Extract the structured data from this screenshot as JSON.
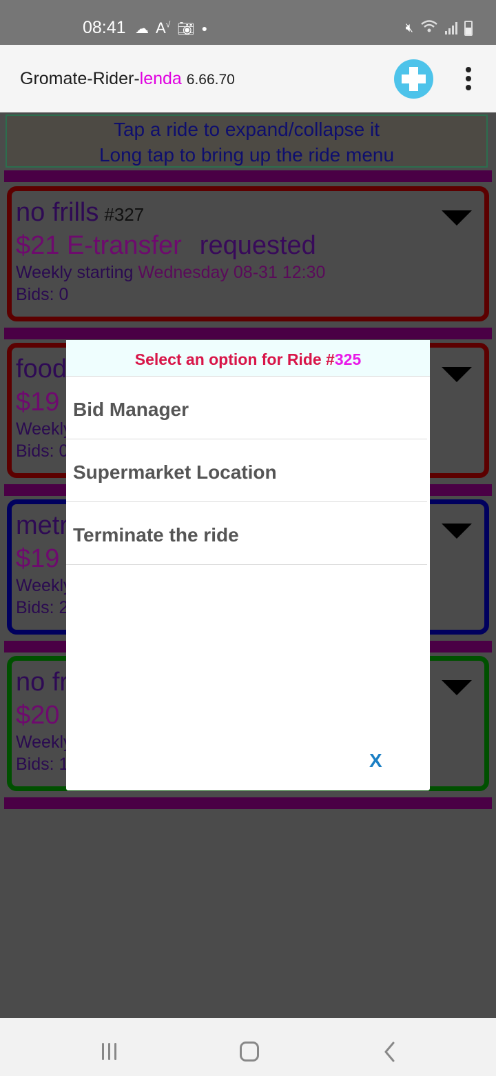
{
  "status_bar": {
    "time": "08:41",
    "left_icons": [
      "cloud-icon",
      "font-size-icon",
      "screenshot-icon",
      "dot-icon"
    ],
    "right_icons": [
      "mute-icon",
      "wifi-icon",
      "signal-icon",
      "battery-icon"
    ]
  },
  "app_bar": {
    "title_prefix": "Gromate-Rider-",
    "title_accent": "lenda",
    "version": "6.66.70",
    "add_icon": "plus-circle-icon",
    "menu_icon": "more-vert-icon",
    "accent_color": "#e000e0"
  },
  "hint": {
    "line1": "Tap a ride to expand/collapse it",
    "line2": "Long tap to bring up the ride menu"
  },
  "rides": [
    {
      "name": "no frills",
      "number": "#327",
      "price": "$21 E-transfer",
      "status": "requested",
      "schedule_prefix": "Weekly starting",
      "schedule_date": "Wednesday 08-31 12:30",
      "bids": "Bids: 0",
      "border_color": "#5c0000"
    },
    {
      "name": "food",
      "price": "$19",
      "schedule_prefix": "Weekly",
      "bids": "Bids: 0",
      "border_color": "#5c0000"
    },
    {
      "name": "metr",
      "price": "$19",
      "schedule_prefix": "Weekly",
      "bids": "Bids: 2",
      "border_color": "#00005e"
    },
    {
      "name": "no fr",
      "price": "$20",
      "schedule_prefix": "Weekly",
      "bids": "Bids: 1",
      "border_color": "#005000"
    }
  ],
  "dialog": {
    "title_prefix": "Select an option for Ride #",
    "ride_number": "325",
    "options": [
      {
        "label": "Bid Manager"
      },
      {
        "label": "Supermarket Location"
      },
      {
        "label": "Terminate the ride"
      }
    ],
    "close_label": "X"
  },
  "nav_bar": {
    "recents_icon": "recents-icon",
    "home_icon": "home-icon",
    "back_icon": "back-icon"
  }
}
